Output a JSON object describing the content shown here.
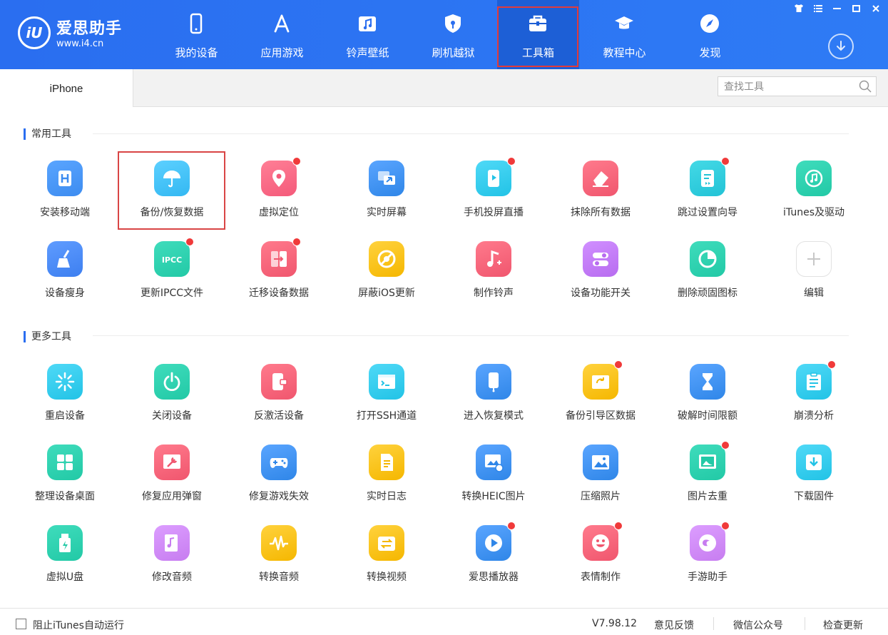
{
  "app": {
    "name": "爱思助手",
    "url": "www.i4.cn",
    "logo_mark": "iU"
  },
  "nav": [
    {
      "label": "我的设备",
      "icon": "phone-icon",
      "active": false
    },
    {
      "label": "应用游戏",
      "icon": "app-store-icon",
      "active": false
    },
    {
      "label": "铃声壁纸",
      "icon": "music-folder-icon",
      "active": false
    },
    {
      "label": "刷机越狱",
      "icon": "shield-icon",
      "active": false
    },
    {
      "label": "工具箱",
      "icon": "toolbox-icon",
      "active": true
    },
    {
      "label": "教程中心",
      "icon": "graduation-cap-icon",
      "active": false
    },
    {
      "label": "发现",
      "icon": "compass-icon",
      "active": false
    }
  ],
  "window_controls": [
    "shirt-icon",
    "menu-icon",
    "minimize-icon",
    "maximize-icon",
    "close-icon"
  ],
  "tabbar": {
    "device_tab": "iPhone",
    "search_placeholder": "查找工具"
  },
  "sections": {
    "common_title": "常用工具",
    "more_title": "更多工具"
  },
  "common_tools": [
    {
      "label": "安装移动端",
      "icon": "install-icon",
      "color": "#3d8cf0",
      "color2": "#5aa5ff",
      "dot": false
    },
    {
      "label": "备份/恢复数据",
      "icon": "umbrella-icon",
      "color": "#33b8f2",
      "color2": "#5cd0ff",
      "dot": false
    },
    {
      "label": "虚拟定位",
      "icon": "location-pin-icon",
      "color": "#f45a7a",
      "color2": "#ff7f96",
      "dot": true
    },
    {
      "label": "实时屏幕",
      "icon": "screen-mirror-icon",
      "color": "#2f86e8",
      "color2": "#5aa5ff",
      "dot": false
    },
    {
      "label": "手机投屏直播",
      "icon": "phone-cast-icon",
      "color": "#22c3e6",
      "color2": "#4fd9f7",
      "dot": true
    },
    {
      "label": "抹除所有数据",
      "icon": "eraser-icon",
      "color": "#f0566e",
      "color2": "#ff7a8c",
      "dot": false
    },
    {
      "label": "跳过设置向导",
      "icon": "skip-setup-icon",
      "color": "#22c3d6",
      "color2": "#44d9e6",
      "dot": true
    },
    {
      "label": "iTunes及驱动",
      "icon": "itunes-icon",
      "color": "#22c9a6",
      "color2": "#3fdcbc",
      "dot": false
    },
    {
      "label": "设备瘦身",
      "icon": "broom-icon",
      "color": "#3d7ff0",
      "color2": "#5f9cff",
      "dot": false
    },
    {
      "label": "更新IPCC文件",
      "icon": "ipcc-icon",
      "color": "#22c9a6",
      "color2": "#3fdcbc",
      "dot": true
    },
    {
      "label": "迁移设备数据",
      "icon": "migrate-icon",
      "color": "#f0566e",
      "color2": "#ff7a8c",
      "dot": true
    },
    {
      "label": "屏蔽iOS更新",
      "icon": "block-update-icon",
      "color": "#f5b700",
      "color2": "#ffd23d",
      "dot": false
    },
    {
      "label": "制作铃声",
      "icon": "music-note-icon",
      "color": "#f0566e",
      "color2": "#ff7a8c",
      "dot": false
    },
    {
      "label": "设备功能开关",
      "icon": "toggle-icon",
      "color": "#b86cf0",
      "color2": "#d08fff",
      "dot": false
    },
    {
      "label": "删除顽固图标",
      "icon": "pie-icon",
      "color": "#22c9a6",
      "color2": "#3fdcbc",
      "dot": false
    },
    {
      "label": "编辑",
      "icon": "plus-icon",
      "color": "#ffffff",
      "color2": "#ffffff",
      "dot": false
    }
  ],
  "more_tools": [
    {
      "label": "重启设备",
      "icon": "restart-icon",
      "color": "#22c3e6",
      "color2": "#4fd9f7",
      "dot": false
    },
    {
      "label": "关闭设备",
      "icon": "power-icon",
      "color": "#22c9a6",
      "color2": "#3fdcbc",
      "dot": false
    },
    {
      "label": "反激活设备",
      "icon": "deactivate-icon",
      "color": "#f0566e",
      "color2": "#ff7a8c",
      "dot": false
    },
    {
      "label": "打开SSH通道",
      "icon": "terminal-icon",
      "color": "#22c3e6",
      "color2": "#4fd9f7",
      "dot": false
    },
    {
      "label": "进入恢复模式",
      "icon": "recovery-mode-icon",
      "color": "#2f86e8",
      "color2": "#5aa5ff",
      "dot": false
    },
    {
      "label": "备份引导区数据",
      "icon": "backup-boot-icon",
      "color": "#f5b700",
      "color2": "#ffd23d",
      "dot": true
    },
    {
      "label": "破解时间限额",
      "icon": "hourglass-icon",
      "color": "#2f86e8",
      "color2": "#5aa5ff",
      "dot": false
    },
    {
      "label": "崩溃分析",
      "icon": "clipboard-icon",
      "color": "#22c3e6",
      "color2": "#4fd9f7",
      "dot": true
    },
    {
      "label": "整理设备桌面",
      "icon": "grid-icon",
      "color": "#22c9a6",
      "color2": "#3fdcbc",
      "dot": false
    },
    {
      "label": "修复应用弹窗",
      "icon": "wrench-icon",
      "color": "#f0566e",
      "color2": "#ff7a8c",
      "dot": false
    },
    {
      "label": "修复游戏失效",
      "icon": "gamepad-icon",
      "color": "#2f86e8",
      "color2": "#5aa5ff",
      "dot": false
    },
    {
      "label": "实时日志",
      "icon": "document-icon",
      "color": "#f5b700",
      "color2": "#ffd23d",
      "dot": false
    },
    {
      "label": "转换HEIC图片",
      "icon": "convert-image-icon",
      "color": "#2f86e8",
      "color2": "#5aa5ff",
      "dot": false
    },
    {
      "label": "压缩照片",
      "icon": "photo-icon",
      "color": "#2f86e8",
      "color2": "#5aa5ff",
      "dot": false
    },
    {
      "label": "图片去重",
      "icon": "dedupe-photo-icon",
      "color": "#22c9a6",
      "color2": "#3fdcbc",
      "dot": true
    },
    {
      "label": "下载固件",
      "icon": "download-firmware-icon",
      "color": "#22c3e6",
      "color2": "#4fd9f7",
      "dot": false
    },
    {
      "label": "虚拟U盘",
      "icon": "usb-drive-icon",
      "color": "#22c9a6",
      "color2": "#3fdcbc",
      "dot": false
    },
    {
      "label": "修改音频",
      "icon": "edit-audio-icon",
      "color": "#c77df0",
      "color2": "#dc9dff",
      "dot": false
    },
    {
      "label": "转换音频",
      "icon": "waveform-icon",
      "color": "#f5b700",
      "color2": "#ffd23d",
      "dot": false
    },
    {
      "label": "转换视频",
      "icon": "video-convert-icon",
      "color": "#f5b700",
      "color2": "#ffd23d",
      "dot": false
    },
    {
      "label": "爱思播放器",
      "icon": "play-icon",
      "color": "#2f86e8",
      "color2": "#5aa5ff",
      "dot": true
    },
    {
      "label": "表情制作",
      "icon": "smiley-icon",
      "color": "#f0566e",
      "color2": "#ff7a8c",
      "dot": true
    },
    {
      "label": "手游助手",
      "icon": "game-assistant-icon",
      "color": "#c77df0",
      "color2": "#dc9dff",
      "dot": true
    }
  ],
  "footer": {
    "checkbox_label": "阻止iTunes自动运行",
    "version": "V7.98.12",
    "feedback": "意见反馈",
    "wechat": "微信公众号",
    "check_update": "检查更新"
  }
}
